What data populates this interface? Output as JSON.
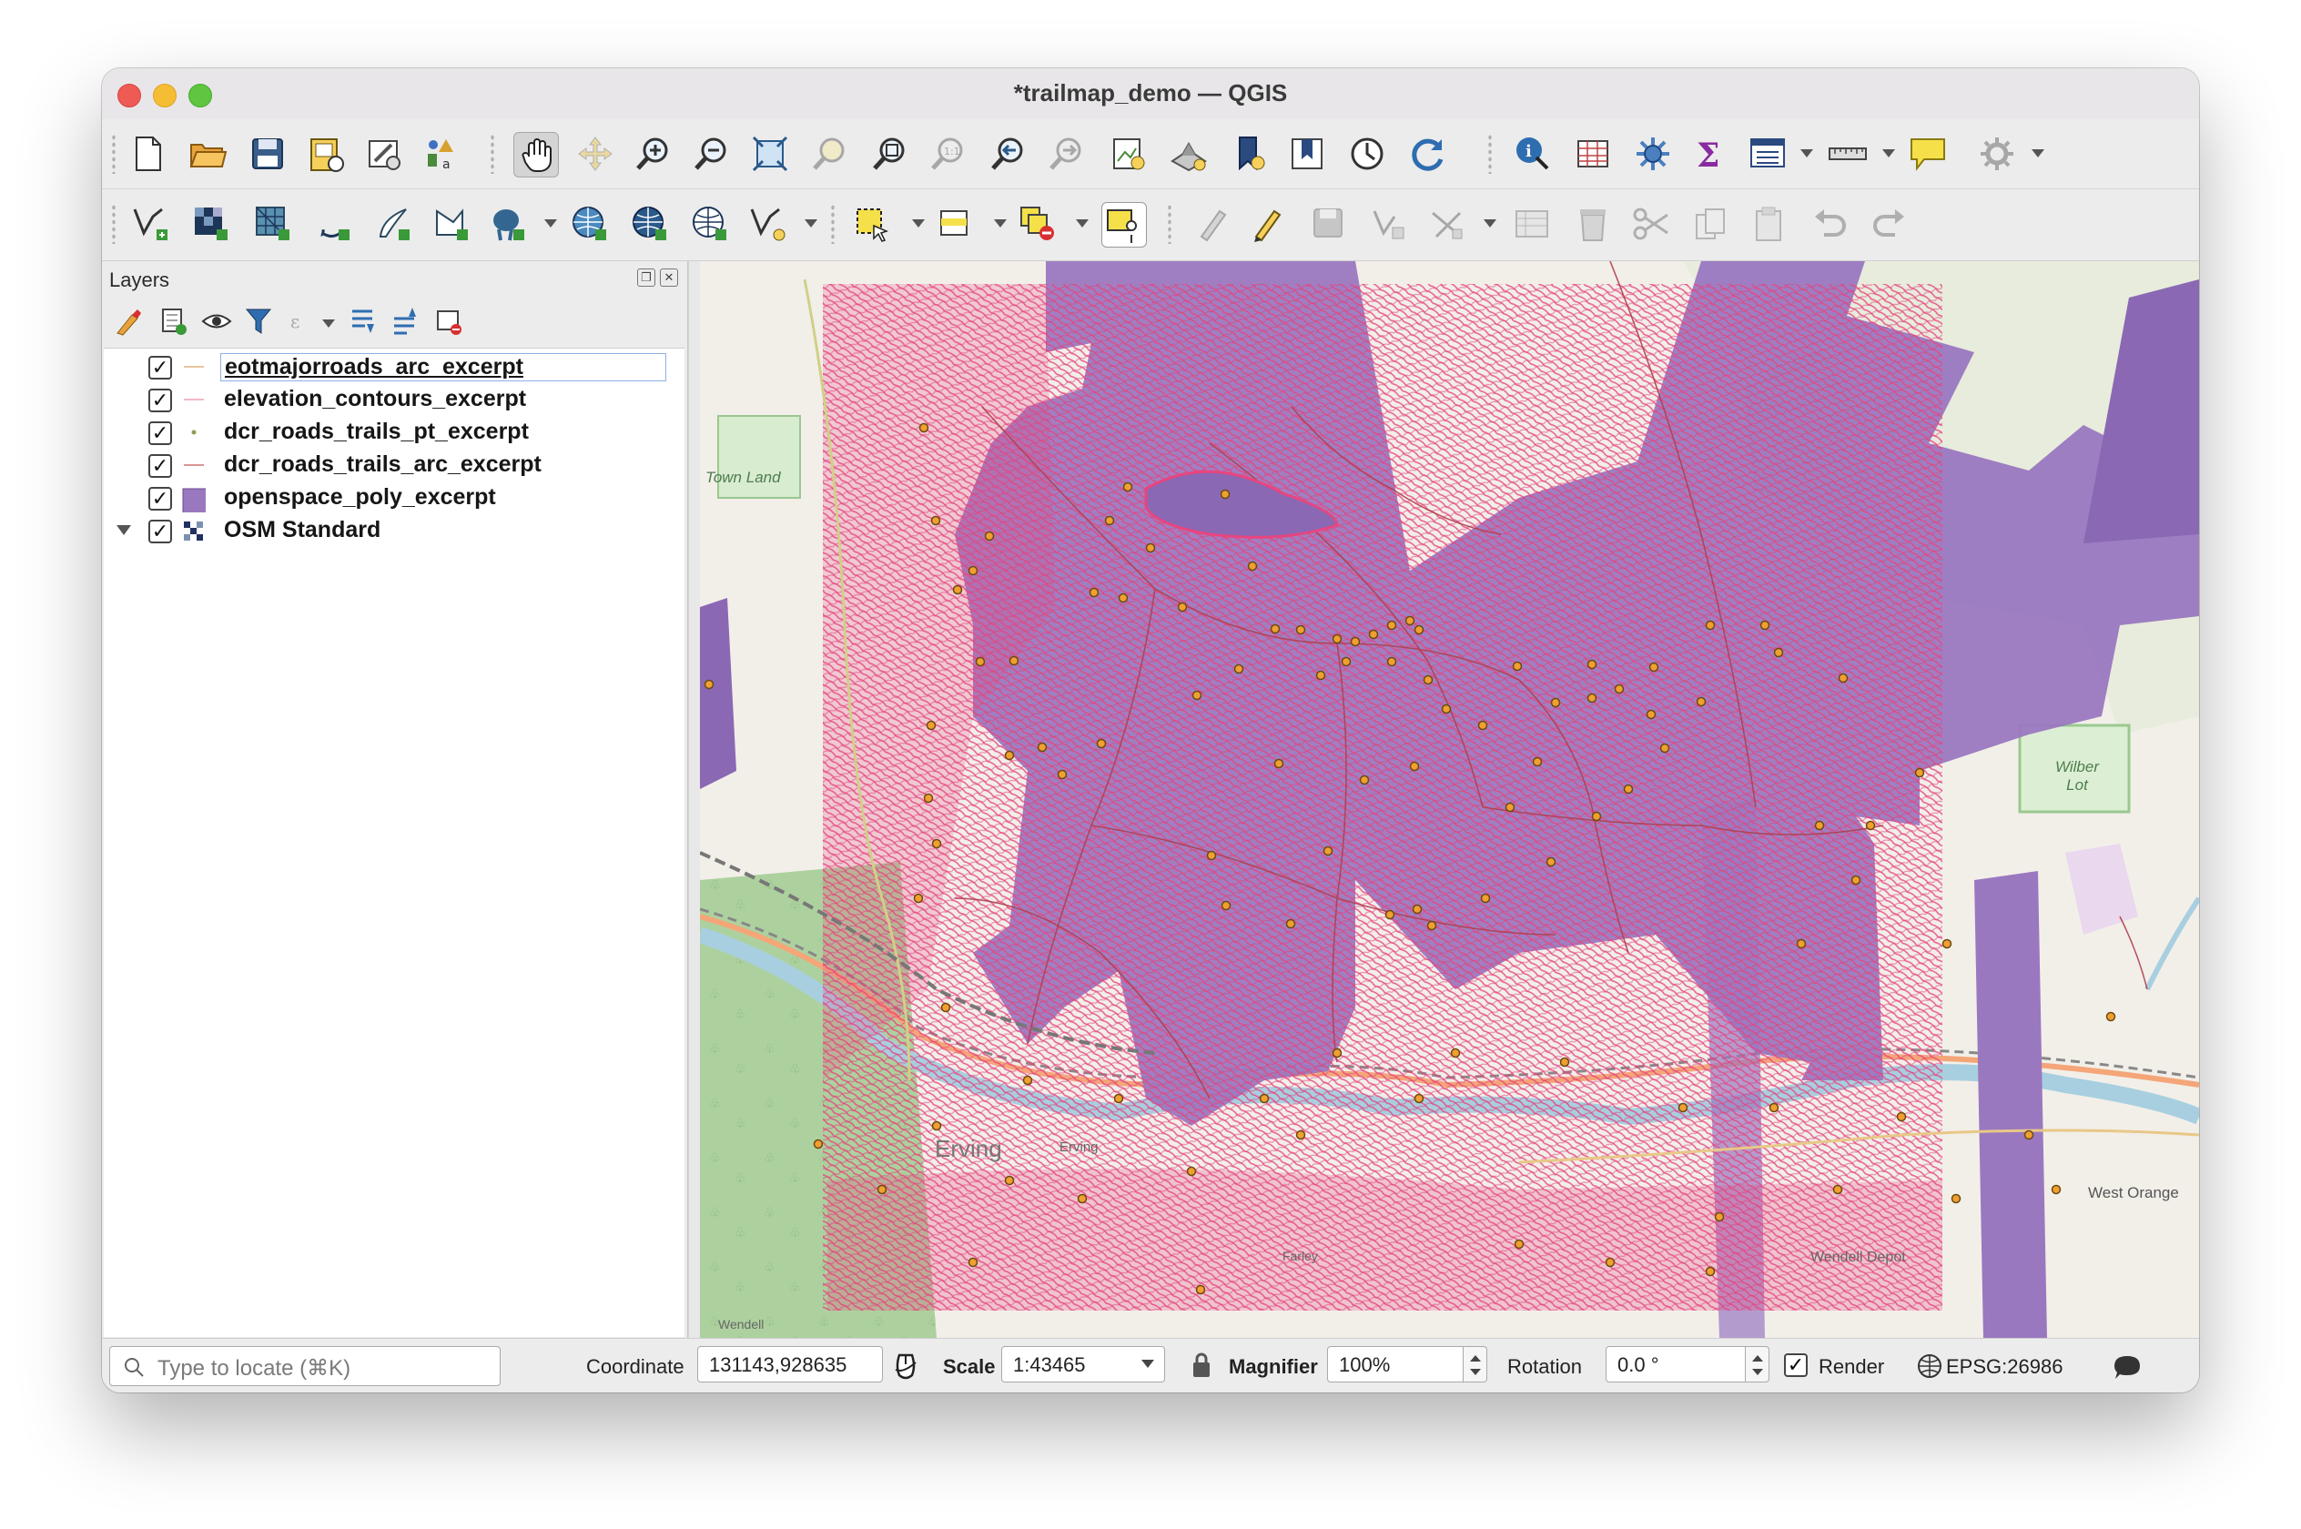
{
  "window": {
    "title": "*trailmap_demo — QGIS",
    "traffic_lights": {
      "close": "#ee5b55",
      "minimize": "#f5bd33",
      "zoom": "#5ec63f"
    }
  },
  "toolbar_top": {
    "tools": [
      "new-project-icon",
      "open-project-icon",
      "save-project-icon",
      "new-print-layout-icon",
      "style-manager-icon",
      "layout-manager-icon",
      "pan-map-icon",
      "pan-to-selection-icon",
      "zoom-in-icon",
      "zoom-out-icon",
      "zoom-full-icon",
      "zoom-to-selection-icon",
      "zoom-to-layer-icon",
      "zoom-native-resolution-icon",
      "zoom-last-icon",
      "zoom-next-icon",
      "new-map-view-icon",
      "new-3d-map-view-icon",
      "new-bookmark-icon",
      "show-bookmarks-icon",
      "temporal-controller-icon",
      "refresh-icon",
      "identify-features-icon",
      "open-attribute-table-icon",
      "toolbox-icon",
      "statistical-summary-icon",
      "field-calculator-icon",
      "measure-line-icon",
      "map-tips-icon",
      "settings-icon"
    ]
  },
  "toolbar_bottom": {
    "tools": [
      "new-shapefile-layer-icon",
      "add-raster-layer-icon",
      "add-mesh-layer-icon",
      "add-delimited-text-icon",
      "add-spatialite-icon",
      "add-virtual-layer-icon",
      "add-postgis-icon",
      "add-wms-icon",
      "add-wcs-icon",
      "add-wfs-icon",
      "add-vector-tile-icon",
      "select-features-icon",
      "select-by-value-icon",
      "deselect-all-icon",
      "add-feature-icon",
      "digitizing-icon",
      "toggle-editing-icon",
      "save-edits-icon",
      "vertex-tool-icon",
      "advanced-digitizing-icon",
      "modify-attributes-icon",
      "delete-selected-icon",
      "cut-features-icon",
      "copy-features-icon",
      "paste-features-icon",
      "undo-icon",
      "redo-icon"
    ]
  },
  "layers_panel": {
    "title": "Layers",
    "tool_icons": [
      "open-layer-styling-icon",
      "add-group-icon",
      "manage-visibility-icon",
      "filter-legend-icon",
      "filter-by-expression-icon",
      "expand-all-icon",
      "collapse-all-icon",
      "remove-layer-icon"
    ],
    "layers": [
      {
        "name": "eotmajorroads_arc_excerpt",
        "checked": "✓",
        "symbol": "line",
        "color": "#e8c8a0",
        "selected": true
      },
      {
        "name": "elevation_contours_excerpt",
        "checked": "✓",
        "symbol": "line",
        "color": "#f0a0b0",
        "selected": false
      },
      {
        "name": "dcr_roads_trails_pt_excerpt",
        "checked": "✓",
        "symbol": "point",
        "color": "#8aa050",
        "selected": false
      },
      {
        "name": "dcr_roads_trails_arc_excerpt",
        "checked": "✓",
        "symbol": "line",
        "color": "#d07070",
        "selected": false
      },
      {
        "name": "openspace_poly_excerpt",
        "checked": "✓",
        "symbol": "fill",
        "color": "#9a78c0",
        "selected": false
      },
      {
        "name": "OSM Standard",
        "checked": "✓",
        "symbol": "tile",
        "color": "#203060",
        "selected": false
      }
    ]
  },
  "map": {
    "labels": {
      "town_land": "Town Land",
      "wilber_lot": "Wilber Lot",
      "erving": "Erving",
      "erving_small": "Erving",
      "west_orange": "West Orange",
      "wendell_depot": "Wendell Depot",
      "wendell": "Wendell",
      "farley": "Farley"
    },
    "colors": {
      "basemap": "#f2efe9",
      "openspace": "#9a78c0",
      "contours": "#e8457f",
      "river": "#a8cfe0",
      "forest": "#add19e",
      "trail_point": "#f0a030"
    }
  },
  "statusbar": {
    "locator_placeholder": "Type to locate (⌘K)",
    "coordinate_label": "Coordinate",
    "coordinate_value": "131143,928635",
    "scale_label": "Scale",
    "scale_value": "1:43465",
    "magnifier_label": "Magnifier",
    "magnifier_value": "100%",
    "rotation_label": "Rotation",
    "rotation_value": "0.0 °",
    "render_label": "Render",
    "render_checked": "✓",
    "crs": "EPSG:26986"
  }
}
